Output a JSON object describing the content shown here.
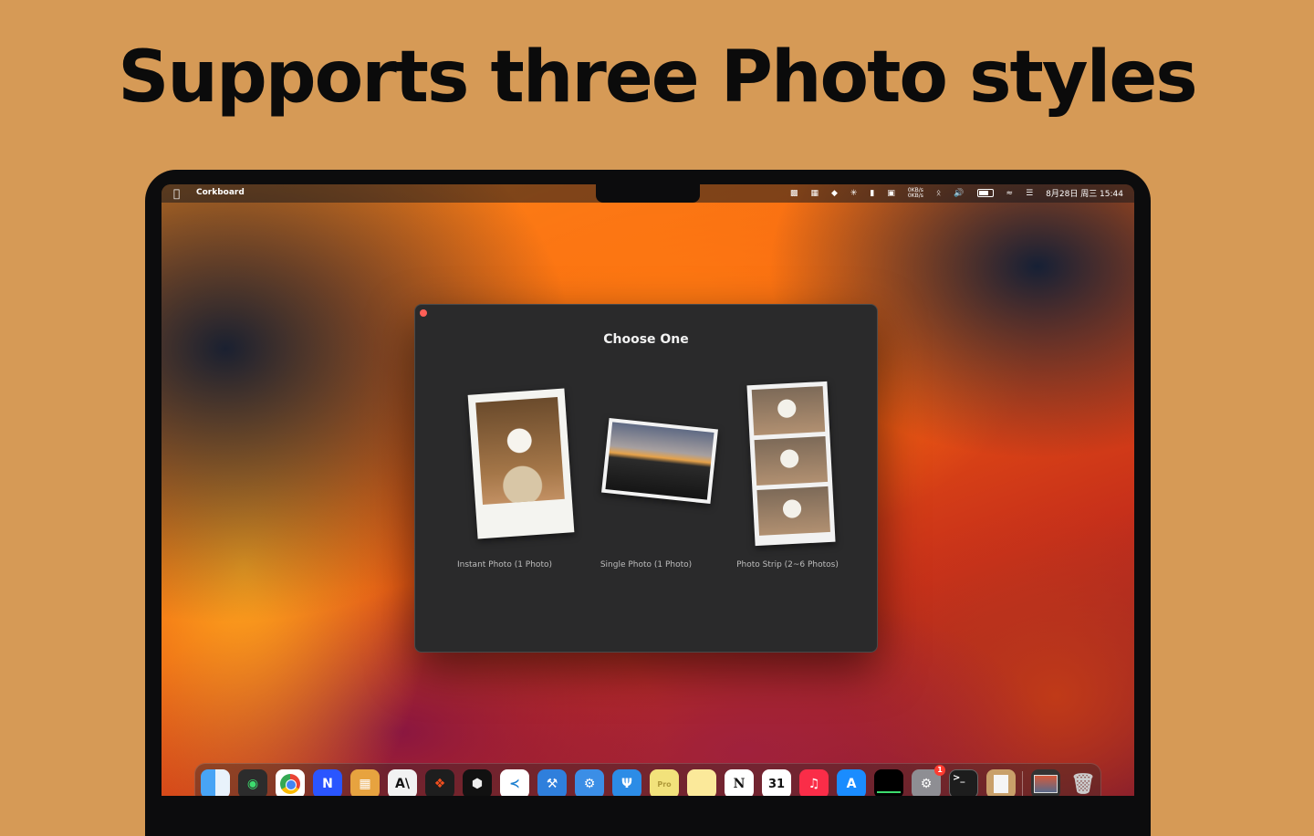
{
  "headline": "Supports three Photo styles",
  "menubar": {
    "app_name": "Corkboard",
    "net_up": "0KB/s",
    "net_down": "0KB/s",
    "clock": "8月28日 周三 15:44"
  },
  "dialog": {
    "title": "Choose One",
    "options": [
      {
        "label": "Instant Photo (1 Photo)"
      },
      {
        "label": "Single Photo (1 Photo)"
      },
      {
        "label": "Photo Strip (2~6 Photos)"
      }
    ]
  },
  "dock": {
    "calendar_day": "31",
    "settings_badge": "1",
    "terminal_prompt": ">_",
    "apps": [
      "Finder",
      "WeChat",
      "Chrome",
      "Noteship",
      "Messages",
      "Anthropic",
      "Figma",
      "Cube",
      "VS Code",
      "Xcode",
      "Simulator",
      "Fork",
      "Stickies Pro",
      "Stickies",
      "Notion",
      "Calendar",
      "Music",
      "App Store",
      "Activity Monitor",
      "System Settings",
      "Terminal",
      "Preview",
      "Screenshot",
      "Trash"
    ]
  }
}
